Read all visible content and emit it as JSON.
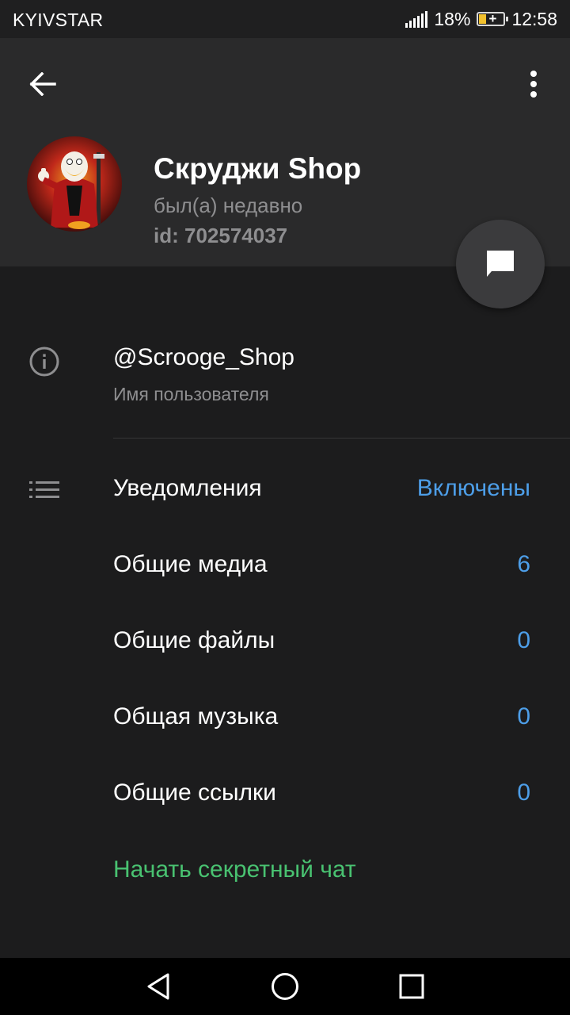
{
  "status_bar": {
    "carrier": "KYIVSTAR",
    "battery": "18%",
    "time": "12:58"
  },
  "header": {
    "back_icon": "arrow-left-icon",
    "menu_icon": "more-vertical-icon",
    "name": "Скруджи Shop",
    "status": "был(а) недавно",
    "id": "id: 702574037"
  },
  "fab_icon": "message-icon",
  "info": {
    "username": "@Scrooge_Shop",
    "username_label": "Имя пользователя"
  },
  "items": [
    {
      "label": "Уведомления",
      "value": "Включены"
    },
    {
      "label": "Общие медиа",
      "value": "6"
    },
    {
      "label": "Общие файлы",
      "value": "0"
    },
    {
      "label": "Общая музыка",
      "value": "0"
    },
    {
      "label": "Общие ссылки",
      "value": "0"
    }
  ],
  "secret_chat": "Начать секретный чат",
  "colors": {
    "accent_blue": "#4d9ee8",
    "accent_green": "#49c271",
    "header_bg": "#2a2a2b",
    "content_bg": "#1c1c1d"
  }
}
